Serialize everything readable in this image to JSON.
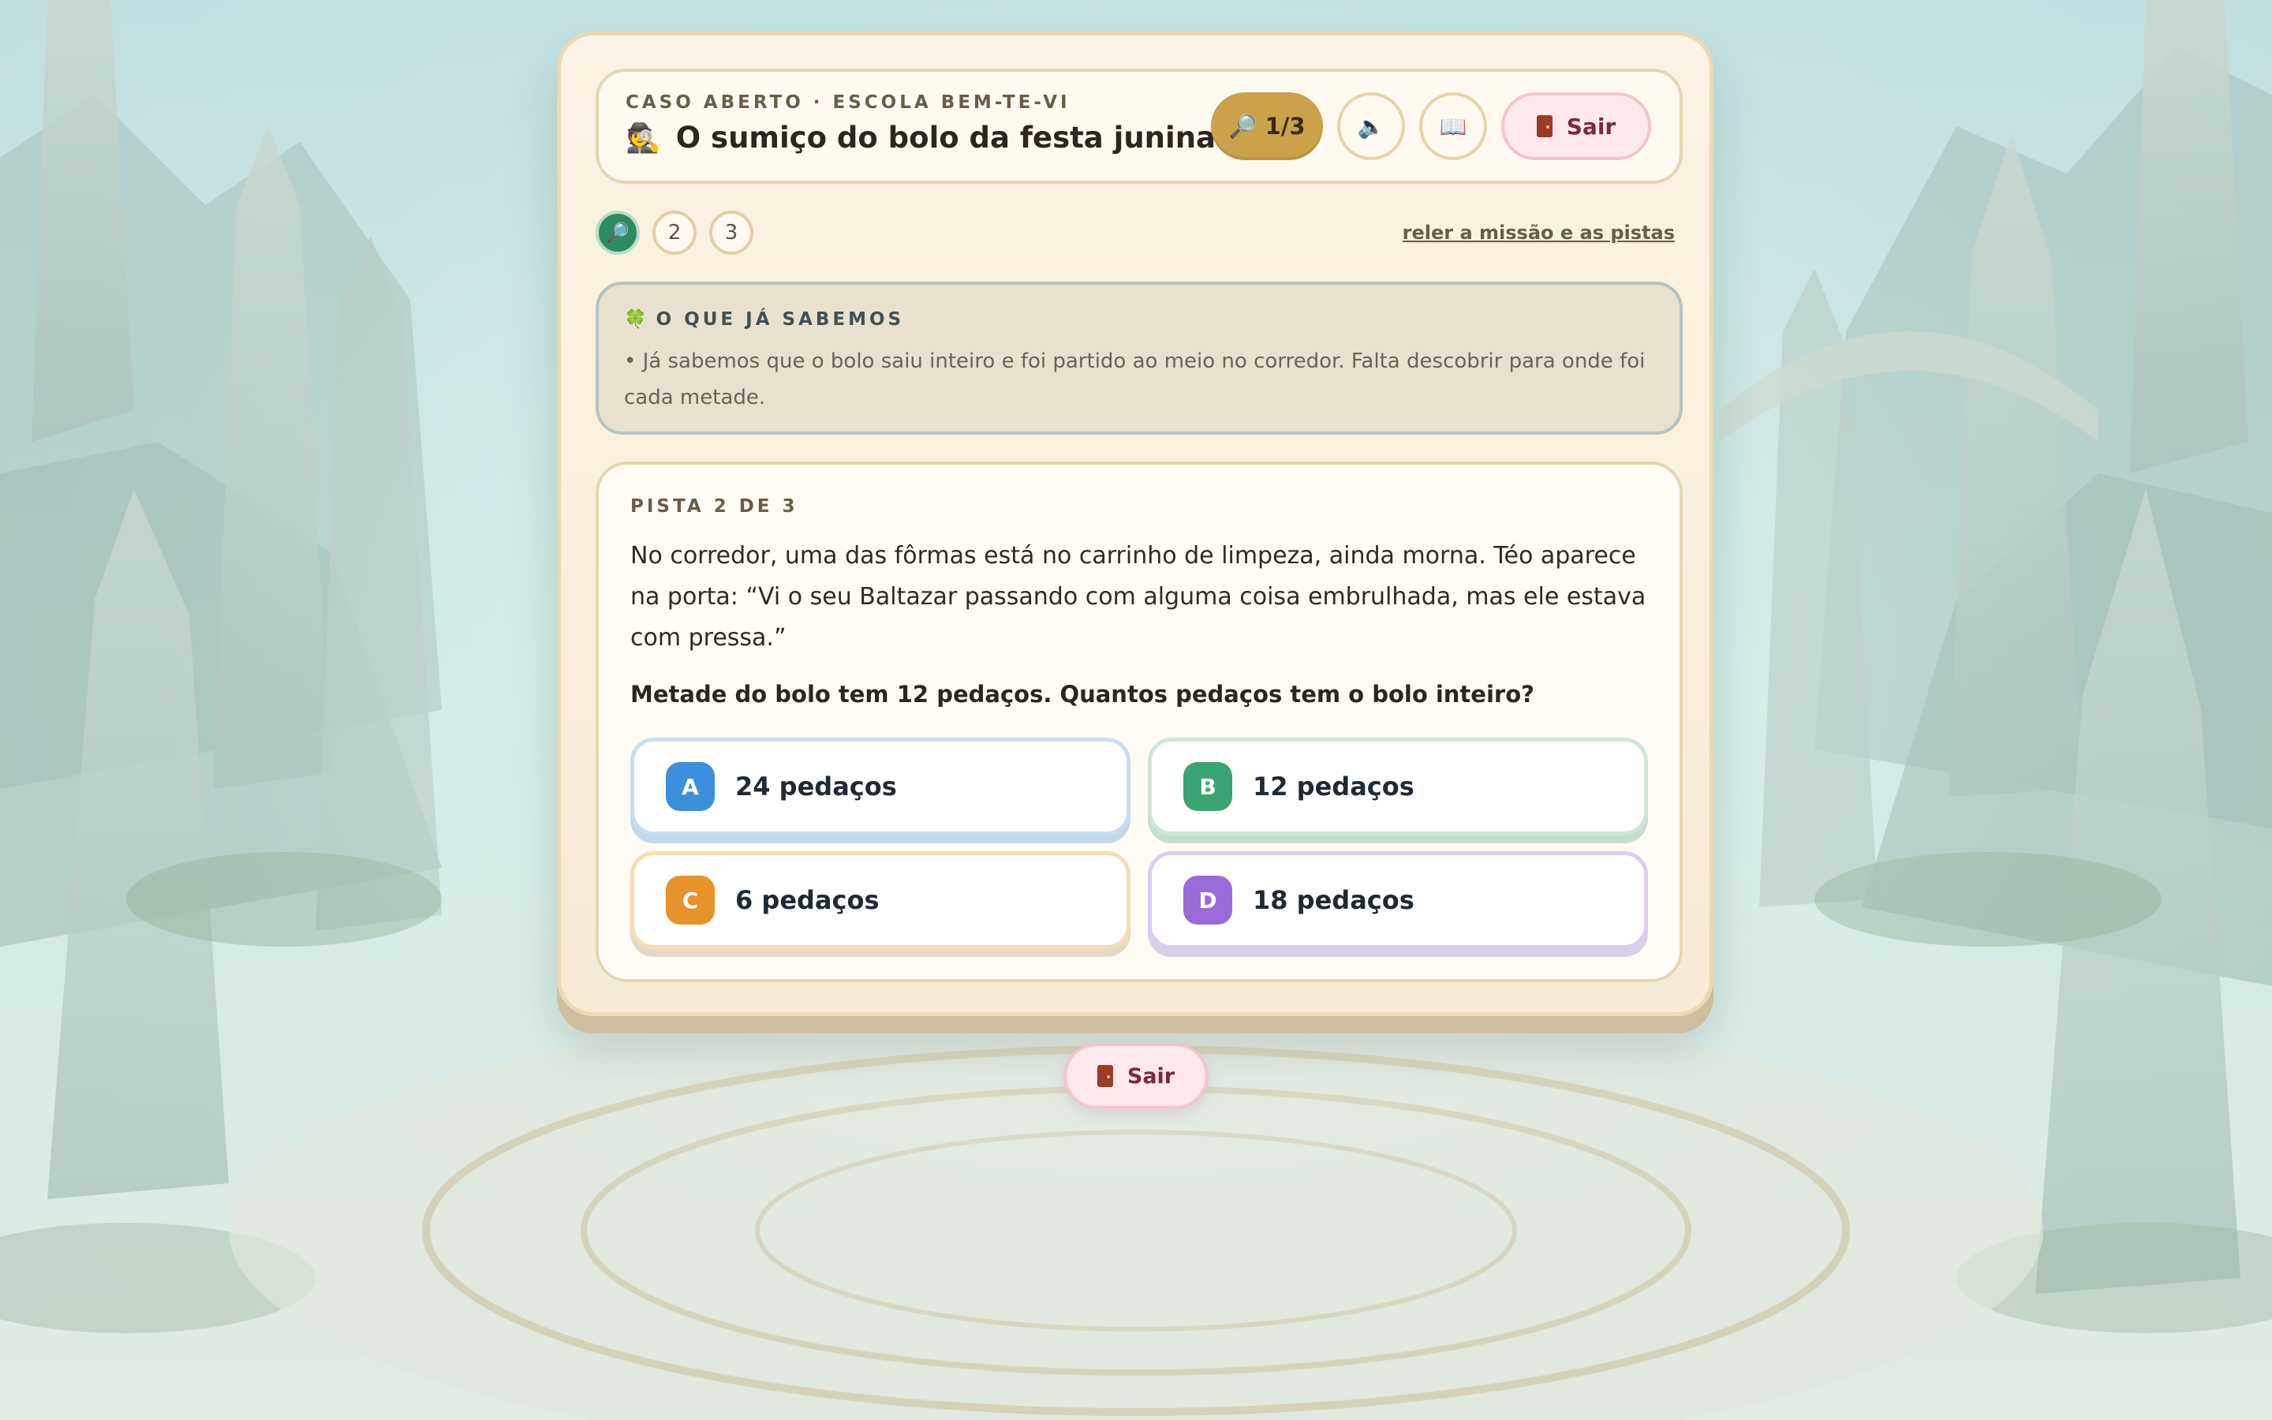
{
  "header": {
    "kicker": "CASO ABERTO · ESCOLA BEM-TE-VI",
    "title": "O sumiço do bolo da festa junina",
    "title_icon": "detective-emoji",
    "clues_counter": "1/3",
    "exit_label": "Sair"
  },
  "progress": {
    "steps": [
      "2",
      "3"
    ],
    "active_step_icon": "magnifier-icon",
    "reread_link": "reler a missão e as pistas"
  },
  "known": {
    "title": "O QUE JÁ SABEMOS",
    "text": "• Já sabemos que o bolo saiu inteiro e foi partido ao meio no corredor. Falta descobrir para onde foi cada metade."
  },
  "clue": {
    "label": "PISTA 2 DE 3",
    "text": "No corredor, uma das fôrmas está no carrinho de limpeza, ainda morna. Téo aparece na porta: “Vi o seu Baltazar passando com alguma coisa embrulhada, mas ele estava com pressa.”",
    "question": "Metade do bolo tem 12 pedaços. Quantos pedaços tem o bolo inteiro?",
    "options": [
      {
        "letter": "A",
        "label": "24 pedaços",
        "color": "#3b8fdc"
      },
      {
        "letter": "B",
        "label": "12 pedaços",
        "color": "#3aa472"
      },
      {
        "letter": "C",
        "label": "6 pedaços",
        "color": "#e8922a"
      },
      {
        "letter": "D",
        "label": "18 pedaços",
        "color": "#9a6ad6"
      }
    ]
  },
  "footer": {
    "exit_label": "Sair"
  },
  "colors": {
    "accent_gold": "#c9a24a",
    "active_green": "#2e8a62",
    "exit_pink": "#fde8ec"
  }
}
